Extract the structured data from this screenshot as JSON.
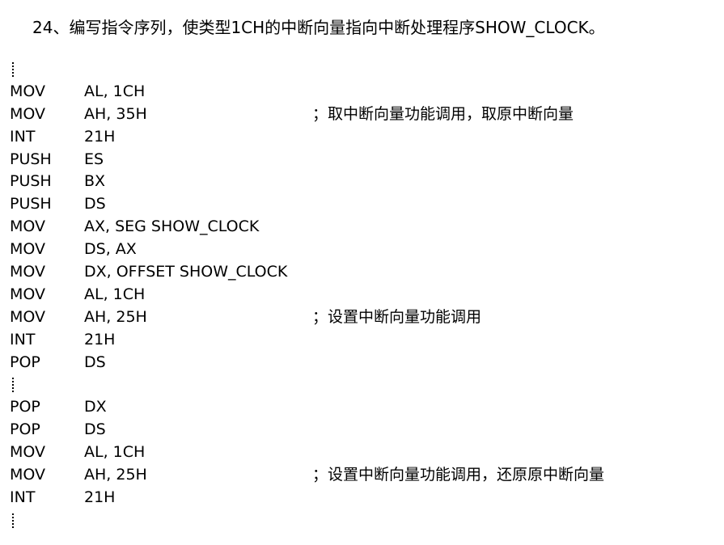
{
  "title": "24、编写指令序列，使类型1CH的中断向量指向中断处理程序SHOW_CLOCK。",
  "lines": [
    {
      "type": "ellipsis"
    },
    {
      "type": "code",
      "op": "MOV",
      "args": "AL, 1CH",
      "comment": ""
    },
    {
      "type": "code",
      "op": "MOV",
      "args": "AH, 35H",
      "comment": "；取中断向量功能调用，取原中断向量"
    },
    {
      "type": "code",
      "op": "INT",
      "args": "21H",
      "comment": ""
    },
    {
      "type": "code",
      "op": "PUSH",
      "args": "ES",
      "comment": ""
    },
    {
      "type": "code",
      "op": "PUSH",
      "args": "BX",
      "comment": ""
    },
    {
      "type": "code",
      "op": "PUSH",
      "args": "DS",
      "comment": ""
    },
    {
      "type": "code",
      "op": "MOV",
      "args": "AX, SEG SHOW_CLOCK",
      "comment": ""
    },
    {
      "type": "code",
      "op": "MOV",
      "args": "DS, AX",
      "comment": ""
    },
    {
      "type": "code",
      "op": "MOV",
      "args": "DX, OFFSET SHOW_CLOCK",
      "comment": ""
    },
    {
      "type": "code",
      "op": "MOV",
      "args": "AL, 1CH",
      "comment": ""
    },
    {
      "type": "code",
      "op": "MOV",
      "args": "AH, 25H",
      "comment": "；设置中断向量功能调用"
    },
    {
      "type": "code",
      "op": "INT",
      "args": "21H",
      "comment": ""
    },
    {
      "type": "code",
      "op": "POP",
      "args": "DS",
      "comment": ""
    },
    {
      "type": "ellipsis"
    },
    {
      "type": "code",
      "op": "POP",
      "args": "DX",
      "comment": ""
    },
    {
      "type": "code",
      "op": "POP",
      "args": "DS",
      "comment": ""
    },
    {
      "type": "code",
      "op": "MOV",
      "args": "AL, 1CH",
      "comment": ""
    },
    {
      "type": "code",
      "op": "MOV",
      "args": "AH, 25H",
      "comment": "；设置中断向量功能调用，还原原中断向量"
    },
    {
      "type": "code",
      "op": "INT",
      "args": "21H",
      "comment": ""
    },
    {
      "type": "ellipsis"
    }
  ]
}
